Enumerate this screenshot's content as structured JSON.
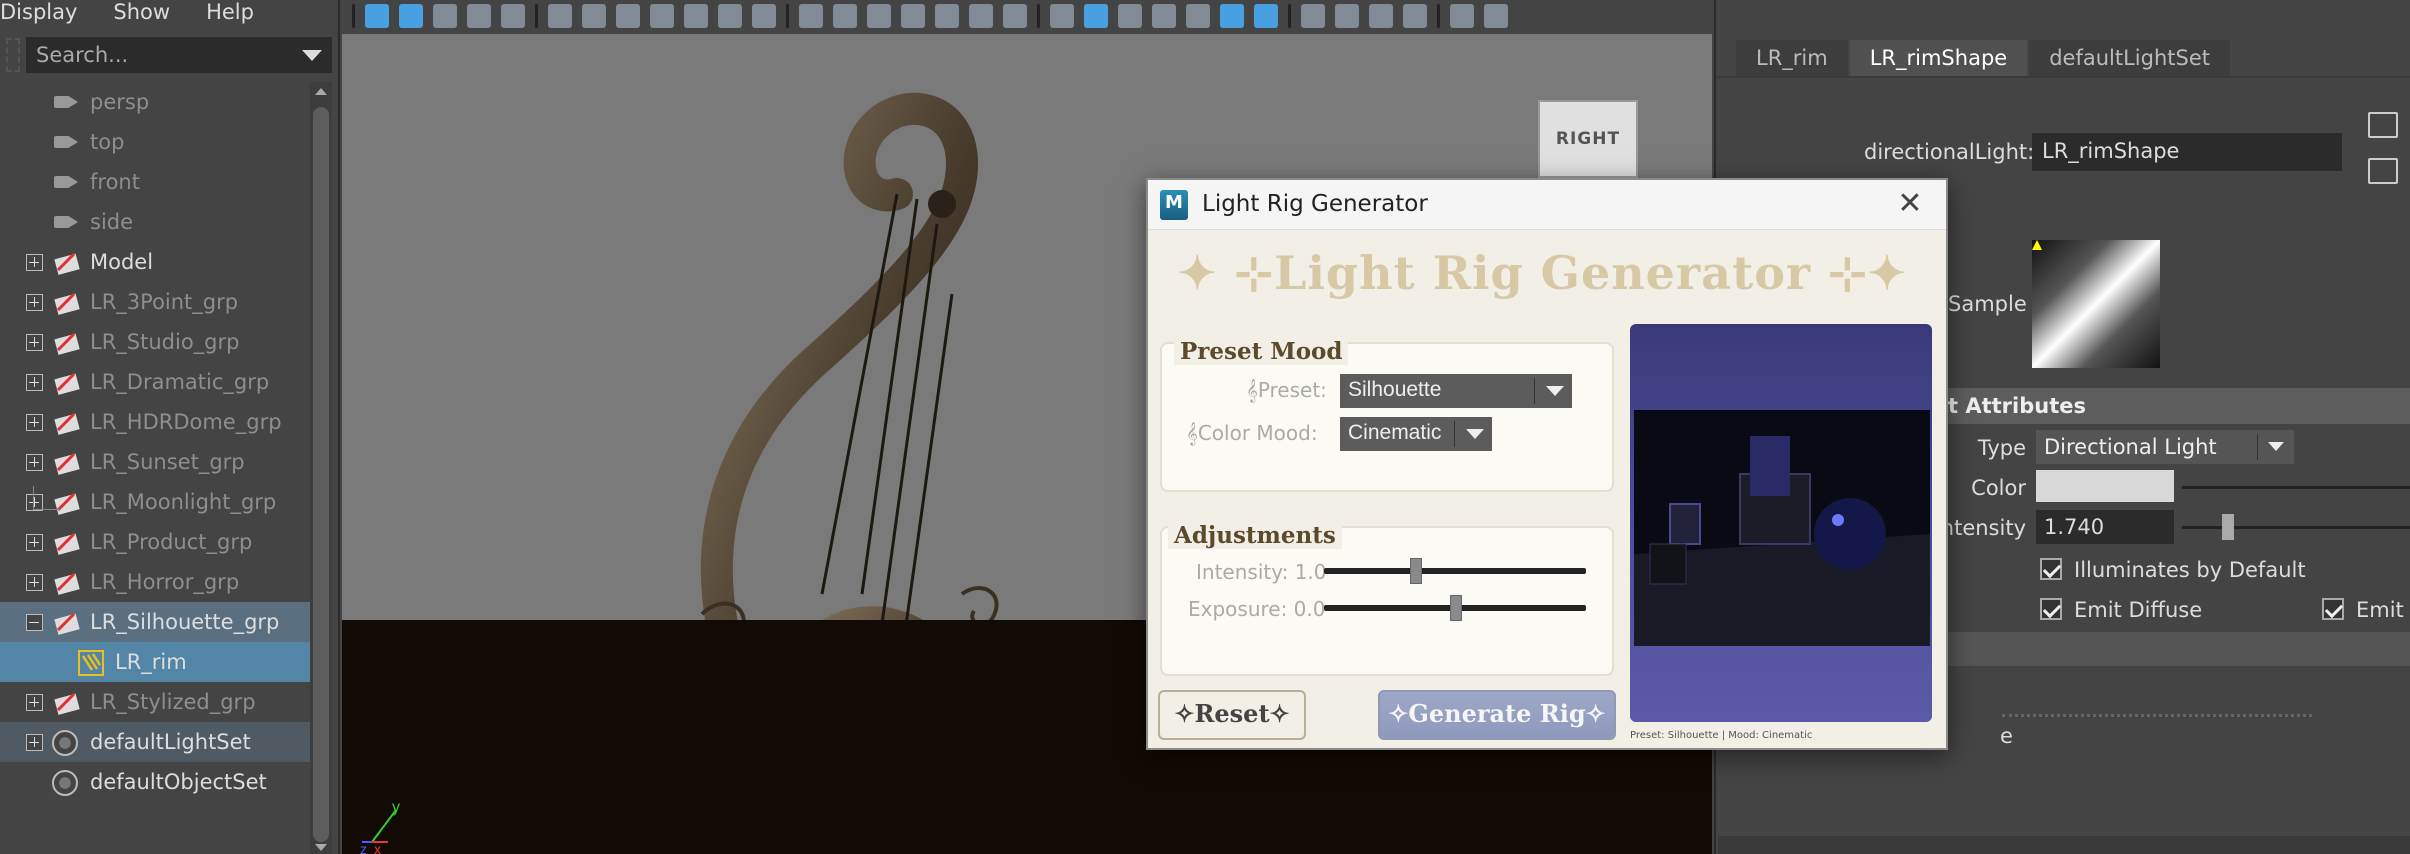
{
  "menu": {
    "display": "Display",
    "show": "Show",
    "help": "Help"
  },
  "outliner": {
    "search_placeholder": "Search...",
    "items": [
      {
        "label": "persp"
      },
      {
        "label": "top"
      },
      {
        "label": "front"
      },
      {
        "label": "side"
      },
      {
        "label": "Model"
      },
      {
        "label": "LR_3Point_grp"
      },
      {
        "label": "LR_Studio_grp"
      },
      {
        "label": "LR_Dramatic_grp"
      },
      {
        "label": "LR_HDRDome_grp"
      },
      {
        "label": "LR_Sunset_grp"
      },
      {
        "label": "LR_Moonlight_grp"
      },
      {
        "label": "LR_Product_grp"
      },
      {
        "label": "LR_Horror_grp"
      },
      {
        "label": "LR_Silhouette_grp"
      },
      {
        "label": "LR_rim"
      },
      {
        "label": "LR_Stylized_grp"
      },
      {
        "label": "defaultLightSet"
      },
      {
        "label": "defaultObjectSet"
      }
    ]
  },
  "viewport": {
    "viewcube_label": "RIGHT",
    "axis_y": "y",
    "axis_z": "z",
    "axis_x": "x"
  },
  "attribute_editor": {
    "tabs": [
      "LR_rim",
      "LR_rimShape",
      "defaultLightSet"
    ],
    "active_tab": "LR_rimShape",
    "node_type_label": "directionalLight:",
    "node_name": "LR_rimShape",
    "sample_label": "Sample",
    "section_title": "t Attributes",
    "type_label": "Type",
    "type_value": "Directional Light",
    "color_label": "Color",
    "color_value": "#d8d8d8",
    "intensity_label": "ntensity",
    "intensity_value": "1.740",
    "illuminates_label": "Illuminates by Default",
    "emit_diffuse_label": "Emit Diffuse",
    "emit_specular_label": "Emit S",
    "cut_label": "e"
  },
  "dialog": {
    "app_icon": "M",
    "title": "Light Rig Generator",
    "banner": "✦ ⊹Light Rig Generator ⊹✦",
    "preset_panel_title": "Preset  Mood",
    "preset_label": "𝄞Preset:",
    "preset_value": "Silhouette",
    "mood_label": "𝄞Color Mood:",
    "mood_value": "Cinematic",
    "adjust_panel_title": "Adjustments",
    "intensity_label": "Intensity: 1.0",
    "intensity_value": 1.0,
    "exposure_label": "Exposure: 0.0",
    "exposure_value": 0.0,
    "reset_label": "✧Reset✧",
    "generate_label": "✧Generate Rig✧",
    "preview_caption": "Preset: Silhouette | Mood: Cinematic"
  }
}
